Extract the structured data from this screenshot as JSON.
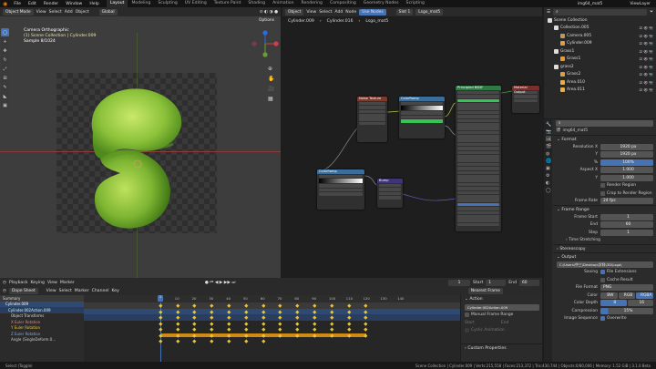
{
  "topbar": {
    "menus": [
      "File",
      "Edit",
      "Render",
      "Window",
      "Help"
    ],
    "workspaces": [
      "Layout",
      "Modeling",
      "Sculpting",
      "UV Editing",
      "Texture Paint",
      "Shading",
      "Animation",
      "Rendering",
      "Compositing",
      "Geometry Nodes",
      "Scripting"
    ],
    "active_workspace": "Layout",
    "file_name": "img64_mat5",
    "view_layer": "ViewLayer",
    "scene_label": "Scene"
  },
  "viewport": {
    "mode": "Object Mode",
    "menus": [
      "View",
      "Select",
      "Add",
      "Object"
    ],
    "orientation": "Global",
    "options": "Options",
    "overlay": {
      "line1": "Camera Orthographic",
      "line2": "(1) Scene Collection | Cylinder.009",
      "line3": "Sample 8/1024"
    }
  },
  "node_editor": {
    "mode": "Object",
    "menus": [
      "View",
      "Select",
      "Add",
      "Node"
    ],
    "use_nodes": "Use Nodes",
    "slot": "Slot 1",
    "material": "Lsgo_mat5",
    "breadcrumb": [
      "Cylinder.009",
      "Cylinder.016",
      "Lsgo_mat5"
    ],
    "nodes": {
      "n1": "Noise Texture",
      "n2": "ColorRamp",
      "n3": "Principled BSDF",
      "n4": "Material Output",
      "n5": "ColorRamp",
      "n6": "Bump"
    }
  },
  "outliner": {
    "title": "Scene Collection",
    "rows": [
      {
        "label": "Collection.005",
        "indent": 1
      },
      {
        "label": "Camera.005",
        "indent": 2
      },
      {
        "label": "Cylinder.009",
        "indent": 2
      },
      {
        "label": "Grass1",
        "indent": 1
      },
      {
        "label": "Grass1",
        "indent": 2
      },
      {
        "label": "grass2",
        "indent": 1
      },
      {
        "label": "Grass2",
        "indent": 2
      },
      {
        "label": "Area.010",
        "indent": 2
      },
      {
        "label": "Area.011",
        "indent": 2
      }
    ]
  },
  "properties": {
    "scene": "img64_mat5",
    "format_title": "Format",
    "rows": [
      {
        "label": "Resolution X",
        "value": "1920 px"
      },
      {
        "label": "Y",
        "value": "1920 px"
      },
      {
        "label": "%",
        "value": "100%"
      },
      {
        "label": "Aspect X",
        "value": "1.000"
      },
      {
        "label": "Y",
        "value": "1.000"
      }
    ],
    "render_region": "Render Region",
    "crop": "Crop to Render Region",
    "frame_rate_label": "Frame Rate",
    "frame_rate": "24 fps",
    "frame_range_title": "Frame Range",
    "frame_start_label": "Frame Start",
    "frame_start": "1",
    "end_label": "End",
    "end": "60",
    "step_label": "Step",
    "step": "1",
    "time_stretching": "Time Stretching",
    "stereoscopy": "Stereoscopy",
    "output_title": "Output",
    "output_path": "C:\\Users\\中三\\Desktop\\学科\\3D\\Lsgo\\",
    "saving_label": "Saving",
    "file_ext": "File Extensions",
    "cache": "Cache Result",
    "file_format_label": "File Format",
    "file_format": "PNG",
    "color_label": "Color",
    "color_opts": [
      "BW",
      "RGB",
      "RGBA"
    ],
    "color_depth_label": "Color Depth",
    "color_depth": [
      "8",
      "16"
    ],
    "compression_label": "Compression",
    "compression": "15%",
    "image_seq_label": "Image Sequence",
    "overwrite": "Overwrite"
  },
  "timeline": {
    "menus": [
      "Playback",
      "Keying",
      "View",
      "Marker"
    ],
    "start_label": "Start",
    "start": "1",
    "end_label": "End",
    "end": "60",
    "current": "1"
  },
  "dope": {
    "mode": "Dope Sheet",
    "menus": [
      "View",
      "Select",
      "Marker",
      "Channel",
      "Key"
    ],
    "nearest": "Nearest Frame",
    "ticks": [
      "0",
      "10",
      "20",
      "30",
      "40",
      "50",
      "60",
      "70",
      "80",
      "90",
      "100",
      "110",
      "120",
      "130",
      "140"
    ],
    "channels": [
      "Summary",
      "Cylinder.009",
      "Cylinder.002Action.009",
      "Object Transforms",
      "X Euler Rotation",
      "Y Euler Rotation",
      "Z Euler Rotation",
      "Angle (SingleDeform.0..."
    ],
    "action_title": "Action",
    "action_name": "Cylinder.002Action.009",
    "manual_frame": "Manual Frame Range",
    "start_lbl": "Start",
    "end_lbl": "End",
    "cyclic": "Cyclic Animation",
    "custom_props": "Custom Properties"
  },
  "status": {
    "left": "Select (Toggle)",
    "right": "Scene Collection | Cylinder.009 | Verts:215,558 | Faces:213,372 | Tris:430,744 | Objects:0/80,006 | Memory: 1.52 GiB | 3.1.0 Beta"
  },
  "colors": {
    "accent": "#4772b3",
    "keyframe": "#e8c535",
    "orange_bar": "#d08a14"
  }
}
